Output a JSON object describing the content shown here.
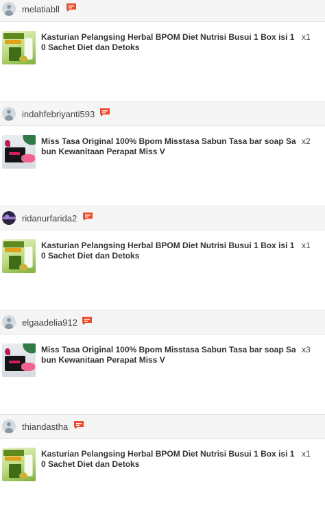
{
  "orders": [
    {
      "username": "melatiabll",
      "product_name": "Kasturian Pelangsing Herbal BPOM Diet Nutrisi Busui 1 Box isi 10 Sachet Diet dan Detoks",
      "quantity": "x1",
      "thumbnail": "kasturian-product-image",
      "avatar": "default-user-icon"
    },
    {
      "username": "indahfebriyanti593",
      "product_name": "Miss Tasa Original 100% Bpom Misstasa Sabun Tasa bar soap Sabun Kewanitaan Perapat Miss V",
      "quantity": "x2",
      "thumbnail": "miss-tasa-product-image",
      "avatar": "default-user-icon"
    },
    {
      "username": "ridanurfarida2",
      "product_name": "Kasturian Pelangsing Herbal BPOM Diet Nutrisi Busui 1 Box isi 10 Sachet Diet dan Detoks",
      "quantity": "x1",
      "thumbnail": "kasturian-product-image",
      "avatar": "profile-photo"
    },
    {
      "username": "elgaadelia912",
      "product_name": "Miss Tasa Original 100% Bpom Misstasa Sabun Tasa bar soap Sabun Kewanitaan Perapat Miss V",
      "quantity": "x3",
      "thumbnail": "miss-tasa-product-image",
      "avatar": "default-user-icon"
    },
    {
      "username": "thiandastha",
      "product_name": "Kasturian Pelangsing Herbal BPOM Diet Nutrisi Busui 1 Box isi 10 Sachet Diet dan Detoks",
      "quantity": "x1",
      "thumbnail": "kasturian-product-image",
      "avatar": "default-user-icon"
    }
  ],
  "colors": {
    "chat_icon": "#ee4d2d",
    "header_background": "#f5f5f5",
    "divider": "#e4e4e4"
  },
  "icons": {
    "chat": "chat-icon"
  }
}
